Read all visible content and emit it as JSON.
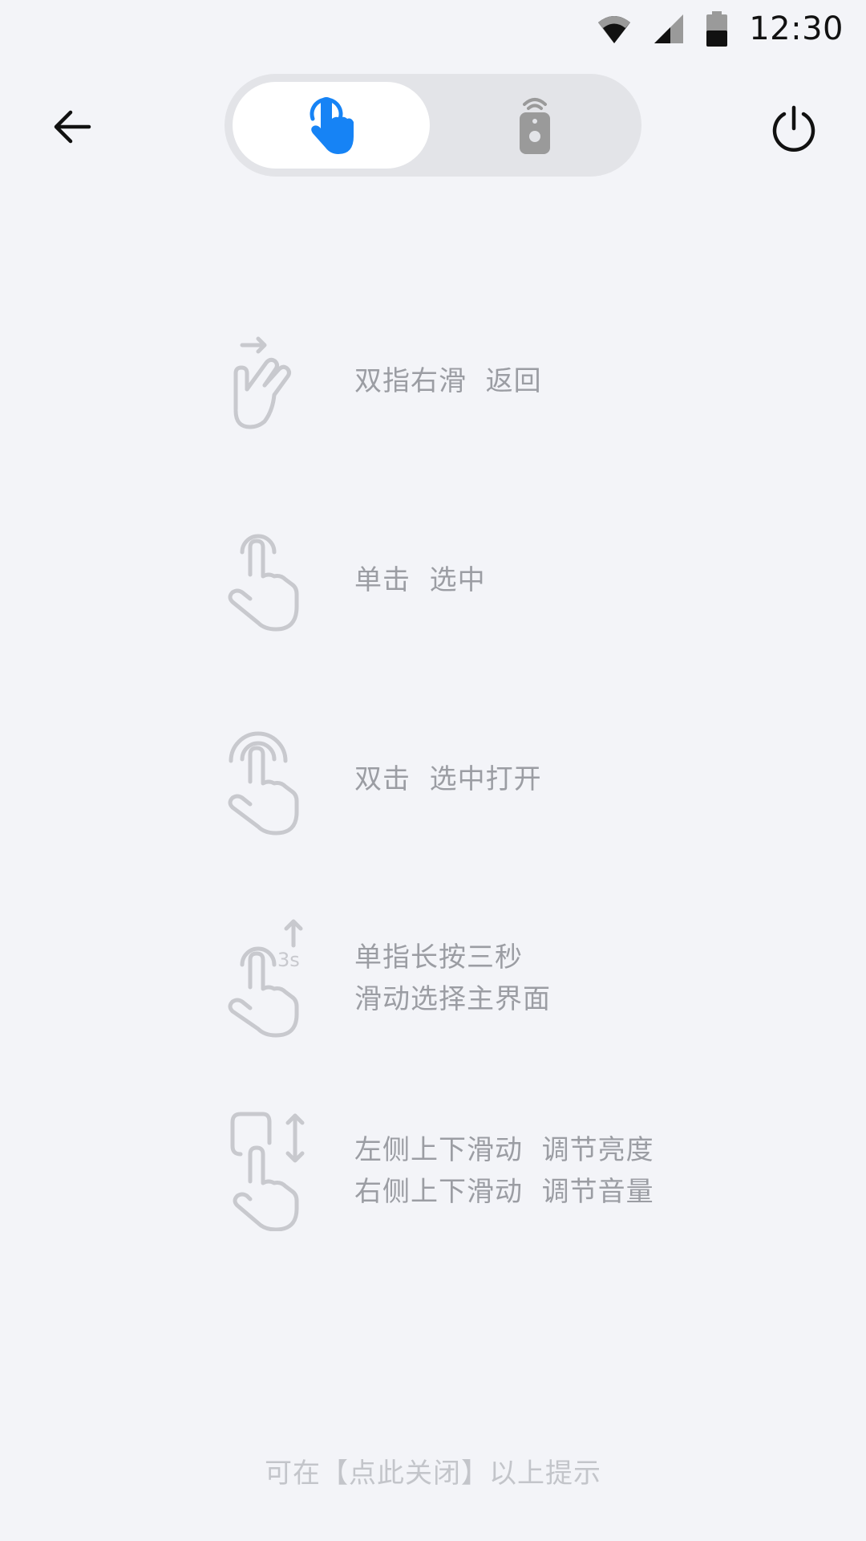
{
  "status_bar": {
    "time": "12:30",
    "icons": [
      "wifi-icon",
      "cellular-signal-icon",
      "battery-icon"
    ]
  },
  "toolbar": {
    "back_icon": "arrow-left-icon",
    "power_icon": "power-icon",
    "mode_toggle": {
      "options": [
        {
          "icon": "touch-hand-icon",
          "selected": true
        },
        {
          "icon": "remote-control-icon",
          "selected": false
        }
      ]
    }
  },
  "gestures": [
    {
      "icon": "two-finger-swipe-right-icon",
      "text": "双指右滑  返回"
    },
    {
      "icon": "single-tap-icon",
      "text": "单击  选中"
    },
    {
      "icon": "double-tap-icon",
      "text": "双击  选中打开"
    },
    {
      "icon": "long-press-3s-icon",
      "text": "单指长按三秒",
      "text2": "滑动选择主界面",
      "badge": "3s"
    },
    {
      "icon": "vertical-swipe-icon",
      "text": "左侧上下滑动  调节亮度",
      "text2": "右侧上下滑动  调节音量"
    }
  ],
  "footer": {
    "hint": "可在【点此关闭】以上提示"
  },
  "colors": {
    "background": "#f3f4f8",
    "accent": "#1683f5",
    "gesture_icon": "#c8c9ce",
    "gesture_text": "#9b9da3",
    "toggle_track": "#e3e4e8"
  }
}
